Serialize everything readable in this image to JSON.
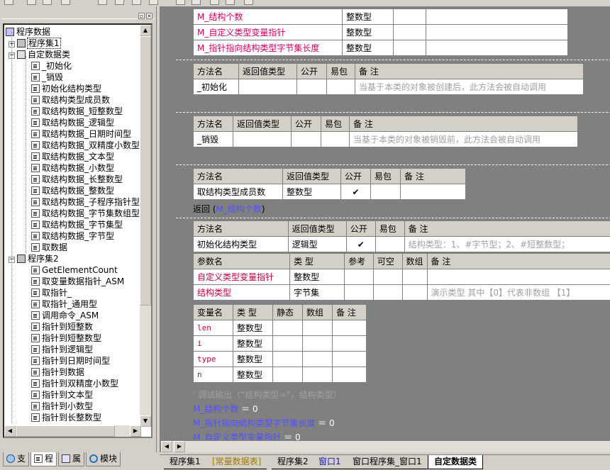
{
  "tree": {
    "root": "程序数据",
    "set1": "程序集1",
    "cls": "自定数据类",
    "methods": [
      "_初始化",
      "_销毁",
      "初始化结构类型",
      "取结构类型成员数",
      "取结构数据_短整数型",
      "取结构数据_逻辑型",
      "取结构数据_日期时间型",
      "取结构数据_双精度小数型",
      "取结构数据_文本型",
      "取结构数据_小数型",
      "取结构数据_长整数型",
      "取结构数据_整数型",
      "取结构数据_子程序指针型",
      "取结构数据_字节集数组型",
      "取结构数据_字节集型",
      "取结构数据_字节型",
      "取数据"
    ],
    "set2": "程序集2",
    "set2items": [
      "GetElementCount",
      "取变量数据指针_ASM",
      "取指针_",
      "取指针_通用型",
      "调用命令_ASM",
      "指针到短整数",
      "指针到短整数型",
      "指针到逻辑型",
      "指针到日期时间型",
      "指针到数据",
      "指针到双精度小数型",
      "指针到文本型",
      "指针到小数型",
      "指针到长整数型"
    ]
  },
  "left_tabs": [
    "支",
    "程",
    "属",
    "模块"
  ],
  "vars": {
    "rows": [
      {
        "name": "M_结构个数",
        "type": "整数型"
      },
      {
        "name": "M_自定义类型变量指针",
        "type": "整数型"
      },
      {
        "name": "M_指针指向结构类型字节集长度",
        "type": "整数型"
      }
    ]
  },
  "method_headers": [
    "方法名",
    "返回值类型",
    "公开",
    "易包",
    "备 注"
  ],
  "param_headers": [
    "参数名",
    "类 型",
    "参考",
    "可空",
    "数组",
    "备 注"
  ],
  "local_headers": [
    "变量名",
    "类 型",
    "静态",
    "数组",
    "备 注"
  ],
  "m_init": {
    "name": "_初始化",
    "remark": "当基于本类的对象被创建后，此方法会被自动调用"
  },
  "m_destroy": {
    "name": "_销毁",
    "remark": "当基于本类的对象被销毁前，此方法会被自动调用"
  },
  "m_count": {
    "name": "取结构类型成员数",
    "ret": "整数型",
    "public": "✔",
    "return_kw": "返回",
    "return_arg": "M_结构个数"
  },
  "m_initstruct": {
    "name": "初始化结构类型",
    "ret": "逻辑型",
    "public": "✔",
    "remark": "结构类型：1、#字节型；2、#短整数型；",
    "params": [
      {
        "name": "自定义类型变量指针",
        "type": "整数型",
        "remark": ""
      },
      {
        "name": "结构类型",
        "type": "字节集",
        "remark": "演示类型 其中【0】代表非数组 【1】"
      }
    ],
    "locals": [
      {
        "name": "len",
        "type": "整数型"
      },
      {
        "name": "i",
        "type": "整数型"
      },
      {
        "name": "type",
        "type": "整数型"
      },
      {
        "name": "n",
        "type": "整数型"
      }
    ]
  },
  "code_lines": {
    "comment": "' 调试输出（“结构类型=”，结构类型）",
    "l1a": "M_结构个数",
    "l1b": " ＝ 0",
    "l2a": "M_指针指向结构类型字节集长度",
    "l2b": " ＝ 0",
    "l3a": "M_自定义类型变量指针",
    "l3b": " ＝ 0"
  },
  "bottom_tabs": [
    "程序集1",
    "[常量数据表]",
    "程序集2",
    "窗口1",
    "窗口程序集_窗口1",
    "自定数据类"
  ]
}
